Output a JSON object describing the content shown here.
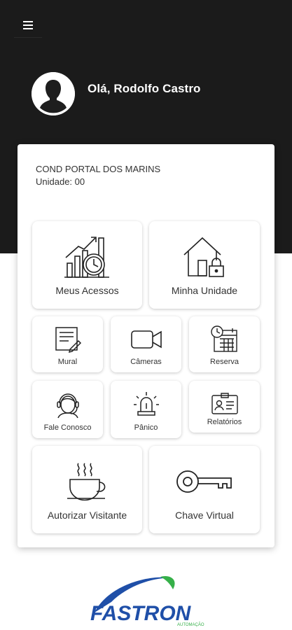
{
  "header": {
    "menu_icon": "hamburger-menu-icon",
    "greeting": "Olá, Rodolfo Castro",
    "avatar_icon": "user-silhouette-icon"
  },
  "condo": {
    "name": "COND PORTAL DOS MARINS",
    "unit": "Unidade: 00"
  },
  "tiles": {
    "meus_acessos": {
      "label": "Meus Acessos",
      "icon": "access-chart-clock-icon"
    },
    "minha_unidade": {
      "label": "Minha Unidade",
      "icon": "house-lock-icon"
    },
    "mural": {
      "label": "Mural",
      "icon": "notice-board-icon"
    },
    "cameras": {
      "label": "Câmeras",
      "icon": "video-camera-icon"
    },
    "reserva": {
      "label": "Reserva",
      "icon": "calendar-clock-icon"
    },
    "fale_conosco": {
      "label": "Fale Conosco",
      "icon": "support-headset-icon"
    },
    "panico": {
      "label": "Pânico",
      "icon": "alarm-siren-icon"
    },
    "relatorios": {
      "label": "Relatórios",
      "icon": "id-card-icon"
    },
    "autorizar_visitante": {
      "label": "Autorizar Visitante",
      "icon": "coffee-cup-icon"
    },
    "chave_virtual": {
      "label": "Chave Virtual",
      "icon": "key-icon"
    }
  },
  "footer": {
    "logo_text": "FASTRON",
    "logo_subtext": "AUTOMAÇÃO",
    "colors": {
      "logo_blue": "#1f4fa8",
      "logo_green": "#36b049"
    }
  },
  "colors": {
    "header_bg": "#1b1b1b",
    "card_bg": "#ffffff",
    "text": "#333333"
  }
}
